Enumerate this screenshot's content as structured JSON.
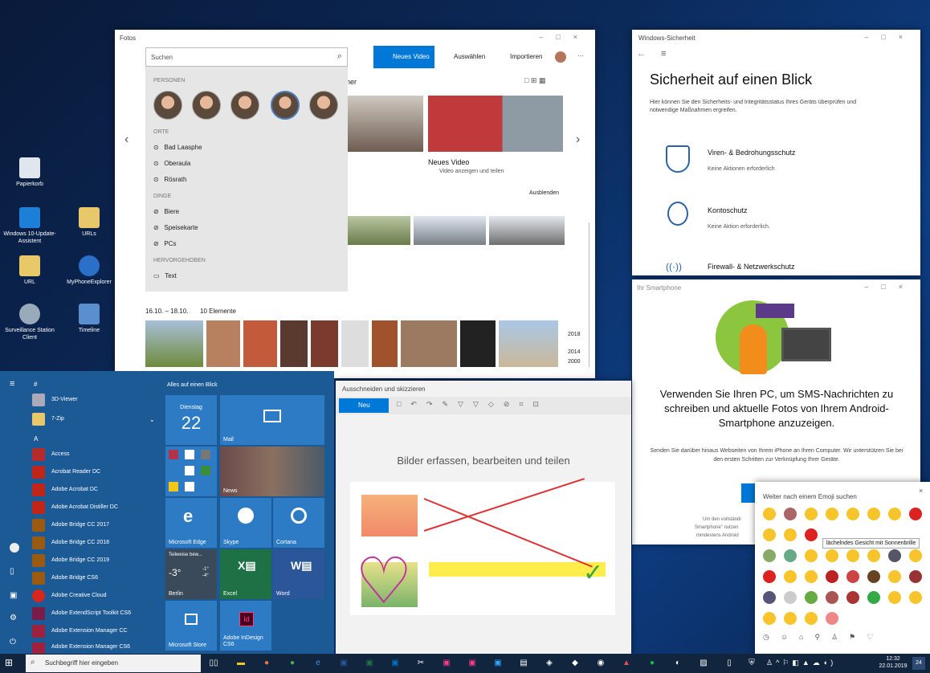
{
  "desktop": {
    "icons": [
      {
        "label": "Papierkorb"
      },
      {
        "label": "Windows 10-Update-Assistent"
      },
      {
        "label": "URLs"
      },
      {
        "label": "URL"
      },
      {
        "label": "MyPhoneExplorer"
      },
      {
        "label": "Surveillance Station Client"
      },
      {
        "label": "Timeline"
      }
    ]
  },
  "fotos": {
    "title": "Fotos",
    "search_placeholder": "Suchen",
    "toolbar": {
      "new_video": "Neues Video",
      "select": "Auswählen",
      "import": "Importieren",
      "more": "···"
    },
    "dropdown": {
      "people_header": "PERSONEN",
      "places_header": "ORTE",
      "places": [
        "Bad Laasphe",
        "Oberaula",
        "Rösrath"
      ],
      "things_header": "DINGE",
      "things": [
        "Biere",
        "Speisekarte",
        "PCs"
      ],
      "featured_header": "HERVORGEHOBEN",
      "featured": [
        "Text"
      ]
    },
    "partial_heading": "ner",
    "new_video_title": "Neues Video",
    "new_video_sub": "Video anzeigen und teilen",
    "hide": "Ausblenden",
    "date_range": "16.10. – 18.10.",
    "count": "10 Elemente",
    "timeline_years": [
      "2018",
      "2014",
      "2000"
    ]
  },
  "security": {
    "title": "Windows-Sicherheit",
    "heading": "Sicherheit auf einen Blick",
    "desc": "Hier können Sie den Sicherheits- und Integritätsstatus Ihres Geräts überprüfen und notwendige Maßnahmen ergreifen.",
    "items": [
      {
        "title": "Viren- & Bedrohungsschutz",
        "sub": "Keine Aktionen erforderlich"
      },
      {
        "title": "Kontoschutz",
        "sub": "Keine Aktion erforderlich."
      },
      {
        "title": "Firewall- & Netzwerkschutz",
        "sub": ""
      }
    ]
  },
  "phone": {
    "title": "Ihr Smartphone",
    "heading": "Verwenden Sie Ihren PC, um SMS-Nachrichten zu schreiben und aktuelle Fotos von Ihrem Android-Smartphone anzuzeigen.",
    "sub": "Senden Sie darüber hinaus Webseiten von Ihrem iPhone an Ihren Computer. Wir unterstützen Sie bei den ersten Schritten zur Verknüpfung Ihrer Geräte.",
    "fine1": "Um den vollständi",
    "fine2": "Smartphone\" nutzen",
    "fine3": "mindestens Android"
  },
  "snip": {
    "title": "Ausschneiden und skizzieren",
    "new_label": "Neu",
    "heading": "Bilder erfassen, bearbeiten und teilen"
  },
  "emoji": {
    "search_label": "Weiter nach einem Emoji suchen",
    "tooltip": "lächelndes Gesicht mit Sonnenbrille"
  },
  "start": {
    "header": "Alles auf einen Blick",
    "hash": "#",
    "letter_a": "A",
    "apps": [
      "3D-Viewer",
      "7-Zip",
      "Access",
      "Acrobat Reader DC",
      "Adobe Acrobat DC",
      "Adobe Acrobat Distiller DC",
      "Adobe Bridge CC 2017",
      "Adobe Bridge CC 2018",
      "Adobe Bridge CC 2019",
      "Adobe Bridge CS6",
      "Adobe Creative Cloud",
      "Adobe ExtendScript Toolkit CS6",
      "Adobe Extension Manager CC",
      "Adobe Extension Manager CS6"
    ],
    "calendar_day": "Dienstag",
    "calendar_num": "22",
    "tiles": {
      "mail": "Mail",
      "news": "News",
      "edge": "Microsoft Edge",
      "skype": "Skype",
      "cortana": "Cortana",
      "weather_head": "Teilweise bew...",
      "temp": "-3°",
      "temp_hi": "-1°",
      "temp_lo": "-4°",
      "city": "Berlin",
      "excel": "Excel",
      "word": "Word",
      "store": "Microsoft Store",
      "indesign": "Adobe InDesign CS6"
    }
  },
  "taskbar": {
    "search": "Suchbegriff hier eingeben",
    "time": "12:32",
    "date": "22.01.2019",
    "notif": "24"
  },
  "colors": {
    "accent": "#0078d7",
    "start_bg": "#1c5a96",
    "tile": "#2d7bc4"
  }
}
